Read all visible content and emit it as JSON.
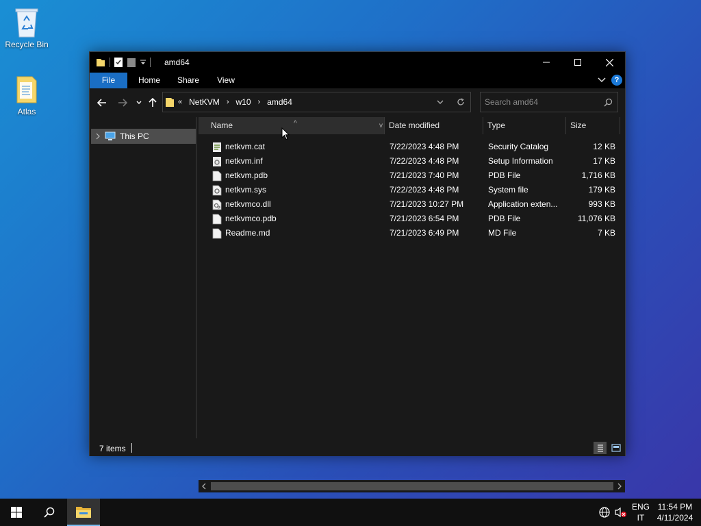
{
  "desktop": {
    "icons": [
      {
        "label": "Recycle Bin",
        "icon": "recycle-bin-icon"
      },
      {
        "label": "Atlas",
        "icon": "folder-icon"
      }
    ]
  },
  "window": {
    "title": "amd64",
    "ribbon_tabs": [
      "File",
      "Home",
      "Share",
      "View"
    ],
    "help_label": "?",
    "address": {
      "overflow": "«",
      "crumbs": [
        "NetKVM",
        "w10",
        "amd64"
      ]
    },
    "search": {
      "placeholder": "Search amd64"
    },
    "nav_pane": {
      "items": [
        {
          "label": "This PC"
        }
      ]
    },
    "columns": [
      "Name",
      "Date modified",
      "Type",
      "Size"
    ],
    "files": [
      {
        "name": "netkvm.cat",
        "date": "7/22/2023 4:48 PM",
        "type": "Security Catalog",
        "size": "12 KB",
        "icon": "security-catalog-icon"
      },
      {
        "name": "netkvm.inf",
        "date": "7/22/2023 4:48 PM",
        "type": "Setup Information",
        "size": "17 KB",
        "icon": "setup-info-icon"
      },
      {
        "name": "netkvm.pdb",
        "date": "7/21/2023 7:40 PM",
        "type": "PDB File",
        "size": "1,716 KB",
        "icon": "file-icon"
      },
      {
        "name": "netkvm.sys",
        "date": "7/22/2023 4:48 PM",
        "type": "System file",
        "size": "179 KB",
        "icon": "system-file-icon"
      },
      {
        "name": "netkvmco.dll",
        "date": "7/21/2023 10:27 PM",
        "type": "Application exten...",
        "size": "993 KB",
        "icon": "dll-file-icon"
      },
      {
        "name": "netkvmco.pdb",
        "date": "7/21/2023 6:54 PM",
        "type": "PDB File",
        "size": "11,076 KB",
        "icon": "file-icon"
      },
      {
        "name": "Readme.md",
        "date": "7/21/2023 6:49 PM",
        "type": "MD File",
        "size": "7 KB",
        "icon": "file-icon"
      }
    ],
    "status": {
      "item_count": "7 items"
    }
  },
  "taskbar": {
    "language": {
      "top": "ENG",
      "bottom": "IT"
    },
    "clock": {
      "time": "11:54 PM",
      "date": "4/11/2024"
    }
  },
  "colors": {
    "accent": "#1a6ec4",
    "window_bg": "#191919",
    "selection": "#4d4d4d",
    "folder": "#f5d66a"
  }
}
